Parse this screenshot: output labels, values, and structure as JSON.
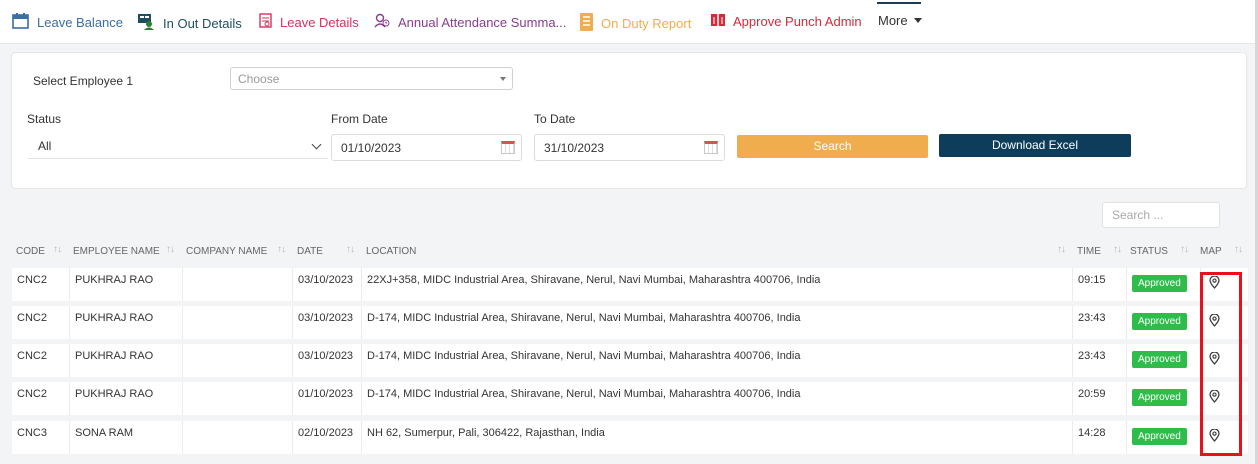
{
  "nav": {
    "items": [
      {
        "label": "Leave Balance",
        "color": "#3a6ea5",
        "icon": "calendar-icon"
      },
      {
        "label": "In Out Details",
        "color": "#1f4e5f",
        "icon": "user-monitor-icon"
      },
      {
        "label": "Leave Details",
        "color": "#d6305e",
        "icon": "document-icon"
      },
      {
        "label": "Annual Attendance Summa...",
        "color": "#8a3c8f",
        "icon": "user-clock-icon"
      },
      {
        "label": "On Duty Report",
        "color": "#f0ad4e",
        "icon": "report-icon"
      },
      {
        "label": "Approve Punch Admin",
        "color": "#d42a3c",
        "icon": "book-icon"
      }
    ],
    "more_label": "More"
  },
  "filters": {
    "employee_label": "Select Employee 1",
    "employee_placeholder": "Choose",
    "status_label": "Status",
    "status_value": "All",
    "from_label": "From Date",
    "from_value": "01/10/2023",
    "to_label": "To Date",
    "to_value": "31/10/2023",
    "search_label": "Search",
    "excel_label": "Download Excel"
  },
  "table_search": {
    "placeholder": "Search ..."
  },
  "table": {
    "headers": {
      "code": "CODE",
      "employee": "EMPLOYEE NAME",
      "company": "COMPANY NAME",
      "date": "DATE",
      "location": "LOCATION",
      "time": "TIME",
      "status": "STATUS",
      "map": "MAP"
    },
    "rows": [
      {
        "code": "CNC2",
        "employee": "PUKHRAJ RAO",
        "company": "",
        "date": "03/10/2023",
        "location": "22XJ+358, MIDC Industrial Area, Shiravane, Nerul, Navi Mumbai, Maharashtra 400706, India",
        "time": "09:15",
        "status": "Approved"
      },
      {
        "code": "CNC2",
        "employee": "PUKHRAJ RAO",
        "company": "",
        "date": "03/10/2023",
        "location": "D-174, MIDC Industrial Area, Shiravane, Nerul, Navi Mumbai, Maharashtra 400706, India",
        "time": "23:43",
        "status": "Approved"
      },
      {
        "code": "CNC2",
        "employee": "PUKHRAJ RAO",
        "company": "",
        "date": "03/10/2023",
        "location": "D-174, MIDC Industrial Area, Shiravane, Nerul, Navi Mumbai, Maharashtra 400706, India",
        "time": "23:43",
        "status": "Approved"
      },
      {
        "code": "CNC2",
        "employee": "PUKHRAJ RAO",
        "company": "",
        "date": "01/10/2023",
        "location": "D-174, MIDC Industrial Area, Shiravane, Nerul, Navi Mumbai, Maharashtra 400706, India",
        "time": "20:59",
        "status": "Approved"
      },
      {
        "code": "CNC3",
        "employee": "SONA RAM",
        "company": "",
        "date": "02/10/2023",
        "location": "NH 62, Sumerpur, Pali, 306422, Rajasthan, India",
        "time": "14:28",
        "status": "Approved"
      }
    ]
  },
  "colors": {
    "status_approved": "#2ebd4a",
    "highlight": "#e8101a",
    "search_button": "#f0ad4e",
    "excel_button": "#0e3c5b"
  }
}
